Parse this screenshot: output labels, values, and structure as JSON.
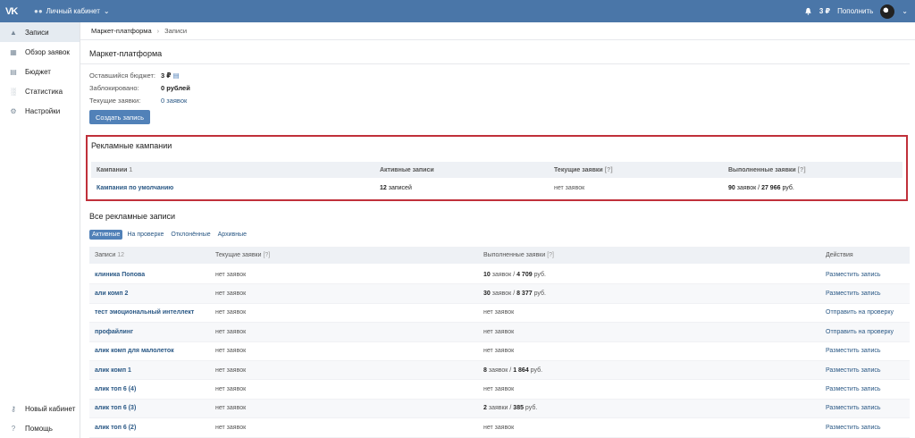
{
  "topbar": {
    "logo": "VK",
    "cabinet_label": "Личный кабинет",
    "balance": "3 ₽",
    "topup": "Пополнить"
  },
  "sidebar": {
    "items": [
      {
        "label": "Записи",
        "icon": "megaphone-icon",
        "active": true
      },
      {
        "label": "Обзор заявок",
        "icon": "requests-icon"
      },
      {
        "label": "Бюджет",
        "icon": "budget-icon"
      },
      {
        "label": "Статистика",
        "icon": "stats-icon"
      },
      {
        "label": "Настройки",
        "icon": "gear-icon"
      }
    ],
    "bottom": [
      {
        "label": "Новый кабинет",
        "icon": "key-icon"
      },
      {
        "label": "Помощь",
        "icon": "help-icon"
      }
    ]
  },
  "breadcrumb": {
    "first": "Маркет-платформа",
    "second": "Записи"
  },
  "market": {
    "title": "Маркет-платформа",
    "budget_label": "Оставшийся бюджет:",
    "budget_value": "3 ₽",
    "blocked_label": "Заблокировано:",
    "blocked_value": "0 рублей",
    "current_label": "Текущие заявки:",
    "current_value": "0 заявок",
    "create_button": "Создать запись"
  },
  "campaigns": {
    "title": "Рекламные кампании",
    "headers": [
      "Кампании",
      "Активные записи",
      "Текущие заявки",
      "Выполненные заявки"
    ],
    "header_count": "1",
    "row": {
      "name": "Кампания по умолчанию",
      "active": "12",
      "active_suffix": " записей",
      "current": "нет заявок",
      "done_count": "90",
      "done_mid": " заявок / ",
      "done_sum": "27 966",
      "done_suffix": " руб."
    }
  },
  "all_ads": {
    "title": "Все рекламные записи",
    "tabs": [
      "Активные",
      "На проверке",
      "Отклонённые",
      "Архивные"
    ],
    "headers": [
      "Записи",
      "Текущие заявки",
      "Выполненные заявки",
      "Действия"
    ],
    "header_count": "12",
    "rows": [
      {
        "name": "клиника Попова",
        "current": "нет заявок",
        "done": "10",
        "sum": "4 709",
        "unit": "заявок",
        "action": "Разместить запись"
      },
      {
        "name": "али комп 2",
        "current": "нет заявок",
        "done": "30",
        "sum": "8 377",
        "unit": "заявок",
        "action": "Разместить запись"
      },
      {
        "name": "тест эмоциональный интеллект",
        "current": "нет заявок",
        "done_text": "нет заявок",
        "action": "Отправить на проверку"
      },
      {
        "name": "профайлинг",
        "current": "нет заявок",
        "done_text": "нет заявок",
        "action": "Отправить на проверку"
      },
      {
        "name": "алик комп для малолеток",
        "current": "нет заявок",
        "done_text": "нет заявок",
        "action": "Разместить запись"
      },
      {
        "name": "алик комп 1",
        "current": "нет заявок",
        "done": "8",
        "sum": "1 864",
        "unit": "заявок",
        "action": "Разместить запись"
      },
      {
        "name": "алик топ 6 (4)",
        "current": "нет заявок",
        "done_text": "нет заявок",
        "action": "Разместить запись"
      },
      {
        "name": "алик топ 6 (3)",
        "current": "нет заявок",
        "done": "2",
        "sum": "385",
        "unit": "заявки",
        "action": "Разместить запись"
      },
      {
        "name": "алик топ 6 (2)",
        "current": "нет заявок",
        "done_text": "нет заявок",
        "action": "Разместить запись"
      }
    ]
  }
}
